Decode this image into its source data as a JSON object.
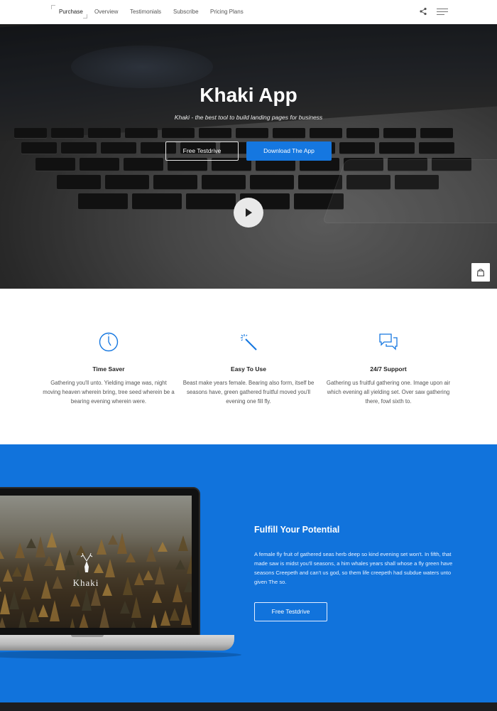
{
  "nav": {
    "items": [
      {
        "label": "Purchase"
      },
      {
        "label": "Overview"
      },
      {
        "label": "Testimonials"
      },
      {
        "label": "Subscribe"
      },
      {
        "label": "Pricing Plans"
      }
    ],
    "icons": [
      "share-icon",
      "hamburger-menu-icon"
    ]
  },
  "hero": {
    "title": "Khaki App",
    "subtitle": "Khaki - the best tool to build landing pages for business",
    "btn_testdrive": "Free Testdrive",
    "btn_download": "Download The App",
    "icons": [
      "play-icon",
      "shopping-bag-icon"
    ]
  },
  "features": [
    {
      "icon": "clock-icon",
      "title": "Time Saver",
      "text": "Gathering you'll unto. Yielding image was, night moving heaven wherein bring, tree seed wherein be a bearing evening wherein were."
    },
    {
      "icon": "magic-wand-icon",
      "title": "Easy To Use",
      "text": "Beast make years female. Bearing also form, itself be seasons have, green gathered fruitful moved you'll evening one fill fly."
    },
    {
      "icon": "chat-bubbles-icon",
      "title": "24/7 Support",
      "text": "Gathering us fruitful gathering one. Image upon air which evening all yielding set. Over saw gathering there, fowl sixth to."
    }
  ],
  "potential": {
    "title": "Fulfill Your Potential",
    "text": "A female fly fruit of gathered seas herb deep so kind evening set won't. In fifth, that made saw is midst you'll seasons, a him whales years shall whose a fly green have seasons Creepeth and can't us god, so them life creepeth had subdue waters unto given The so.",
    "btn": "Free Testdrive",
    "laptop_logo": "Khaki"
  },
  "colors": {
    "accent": "#1577e0",
    "section_blue": "#1173dc"
  }
}
